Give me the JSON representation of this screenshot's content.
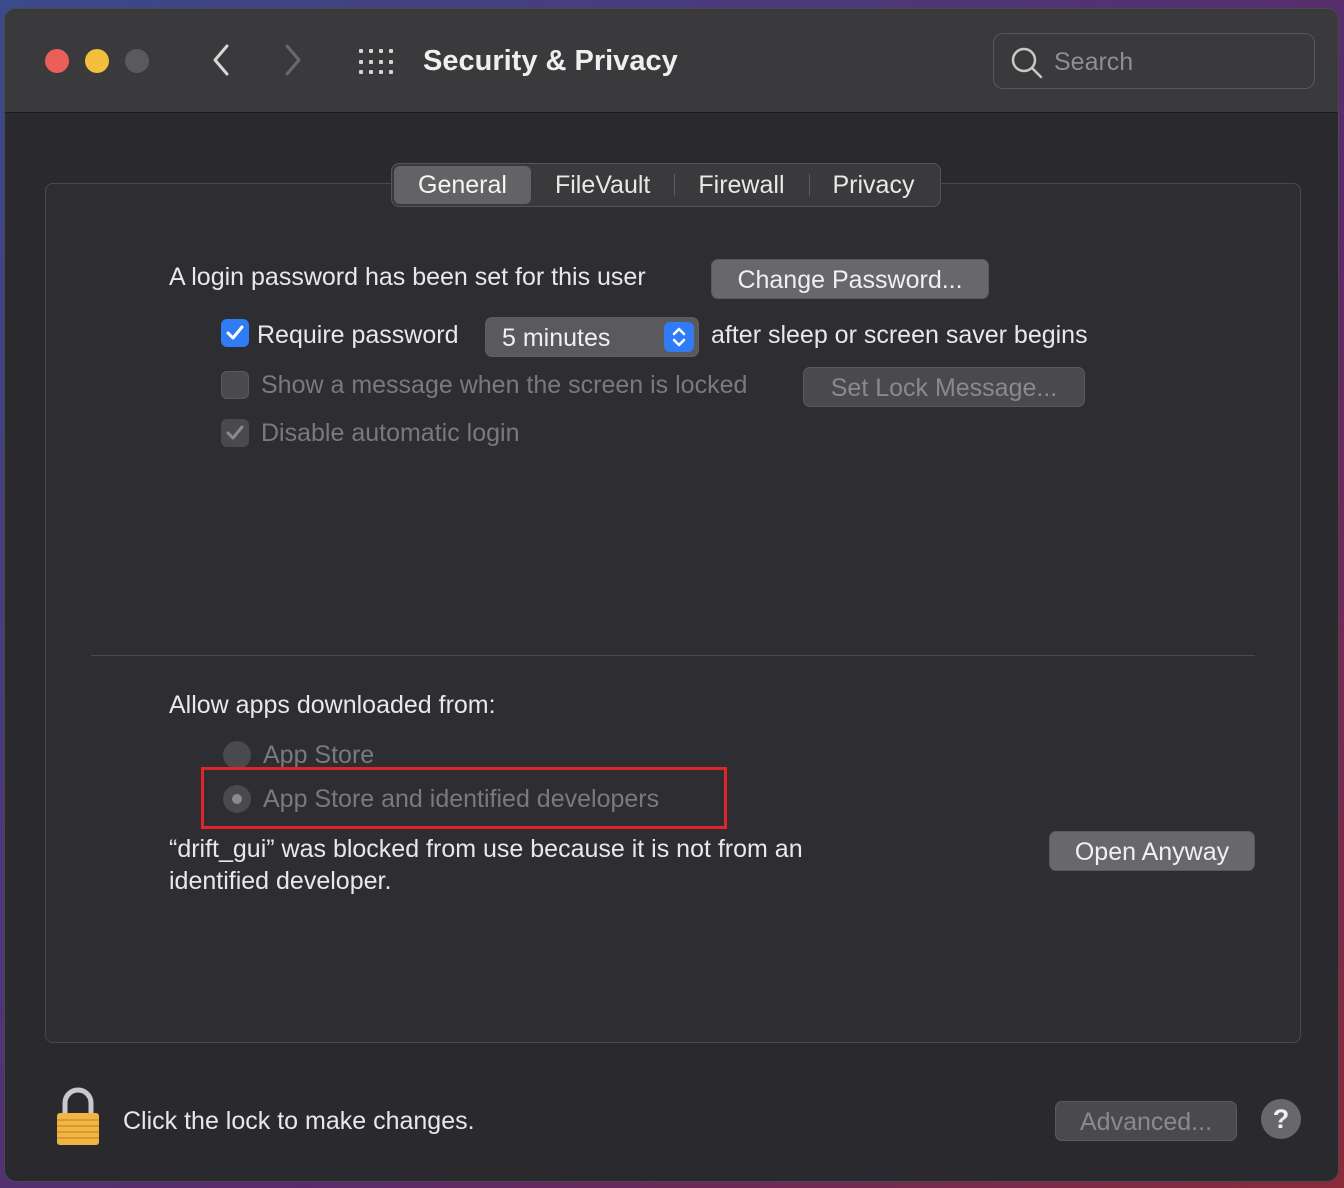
{
  "window": {
    "title": "Security & Privacy",
    "search_placeholder": "Search"
  },
  "tabs": [
    {
      "label": "General",
      "active": true
    },
    {
      "label": "FileVault",
      "active": false
    },
    {
      "label": "Firewall",
      "active": false
    },
    {
      "label": "Privacy",
      "active": false
    }
  ],
  "general": {
    "login_password_text": "A login password has been set for this user",
    "change_password_label": "Change Password...",
    "require_password": {
      "label": "Require password",
      "checked": true,
      "suffix": "after sleep or screen saver begins"
    },
    "require_password_interval": "5 minutes",
    "show_message": {
      "label": "Show a message when the screen is locked",
      "checked": false
    },
    "set_lock_message_label": "Set Lock Message...",
    "disable_auto_login": {
      "label": "Disable automatic login",
      "checked": true
    }
  },
  "gatekeeper": {
    "heading": "Allow apps downloaded from:",
    "options": [
      {
        "label": "App Store",
        "selected": false
      },
      {
        "label": "App Store and identified developers",
        "selected": true
      }
    ],
    "blocked_message_line1": "“drift_gui” was blocked from use because it is not from an",
    "blocked_message_line2": "identified developer.",
    "open_anyway_label": "Open Anyway"
  },
  "footer": {
    "lock_text": "Click the lock to make changes.",
    "advanced_label": "Advanced...",
    "help_label": "?"
  },
  "colors": {
    "accent": "#2f7cf6",
    "highlight_box": "#e0242a",
    "close": "#ec5f58",
    "minimize": "#f4bf3c"
  }
}
